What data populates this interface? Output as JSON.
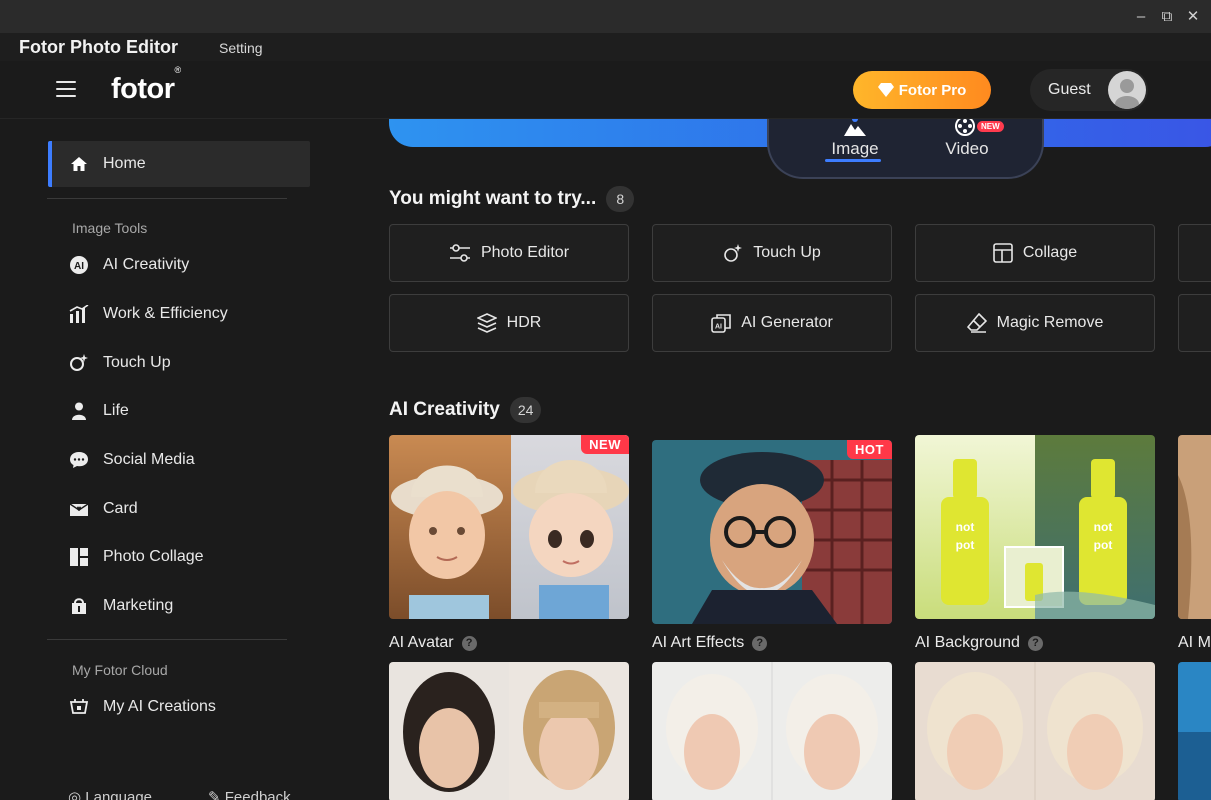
{
  "window": {
    "title": "Fotor Photo Editor",
    "setting_label": "Setting",
    "minimize": "–",
    "restore": "⧉",
    "close": "✕"
  },
  "header": {
    "logo": "fotor",
    "logo_mark": "®",
    "pro_button": "Fotor Pro",
    "guest_label": "Guest"
  },
  "sidebar": {
    "home": "Home",
    "section_image_tools": "Image Tools",
    "items": [
      {
        "label": "AI Creativity",
        "icon": "ai-icon"
      },
      {
        "label": "Work & Efficiency",
        "icon": "chart-icon"
      },
      {
        "label": "Touch Up",
        "icon": "sparkle-face-icon"
      },
      {
        "label": "Life",
        "icon": "person-icon"
      },
      {
        "label": "Social Media",
        "icon": "chat-icon"
      },
      {
        "label": "Card",
        "icon": "card-icon"
      },
      {
        "label": "Photo Collage",
        "icon": "collage-icon"
      },
      {
        "label": "Marketing",
        "icon": "bag-icon"
      }
    ],
    "section_cloud": "My Fotor Cloud",
    "my_ai_creations": "My AI Creations",
    "language": "Language",
    "feedback": "Feedback"
  },
  "main": {
    "switcher": {
      "image_tab": "Image",
      "video_tab": "Video",
      "video_badge": "NEW"
    },
    "try_section": {
      "title": "You might want to try...",
      "count": "8",
      "tools": [
        {
          "label": "Photo Editor",
          "icon": "sliders-icon"
        },
        {
          "label": "Touch Up",
          "icon": "sparkle-face-icon"
        },
        {
          "label": "Collage",
          "icon": "collage-layout-icon"
        },
        {
          "label": "HDR",
          "icon": "layers-icon"
        },
        {
          "label": "AI Generator",
          "icon": "ai-generator-icon"
        },
        {
          "label": "Magic Remove",
          "icon": "eraser-icon"
        }
      ]
    },
    "ai_section": {
      "title": "AI Creativity",
      "count": "24",
      "cards": [
        {
          "label": "AI Avatar",
          "badge": "NEW"
        },
        {
          "label": "AI Art Effects",
          "badge": "HOT"
        },
        {
          "label": "AI Background",
          "badge": ""
        },
        {
          "label": "AI M",
          "badge": ""
        }
      ],
      "help": "?"
    },
    "product_text": {
      "line1": "not",
      "line2": "pot"
    }
  },
  "colors": {
    "accent": "#3d7dff",
    "pro_start": "#ffb62a",
    "pro_end": "#ff8a1f",
    "badge_red": "#ff3848"
  }
}
